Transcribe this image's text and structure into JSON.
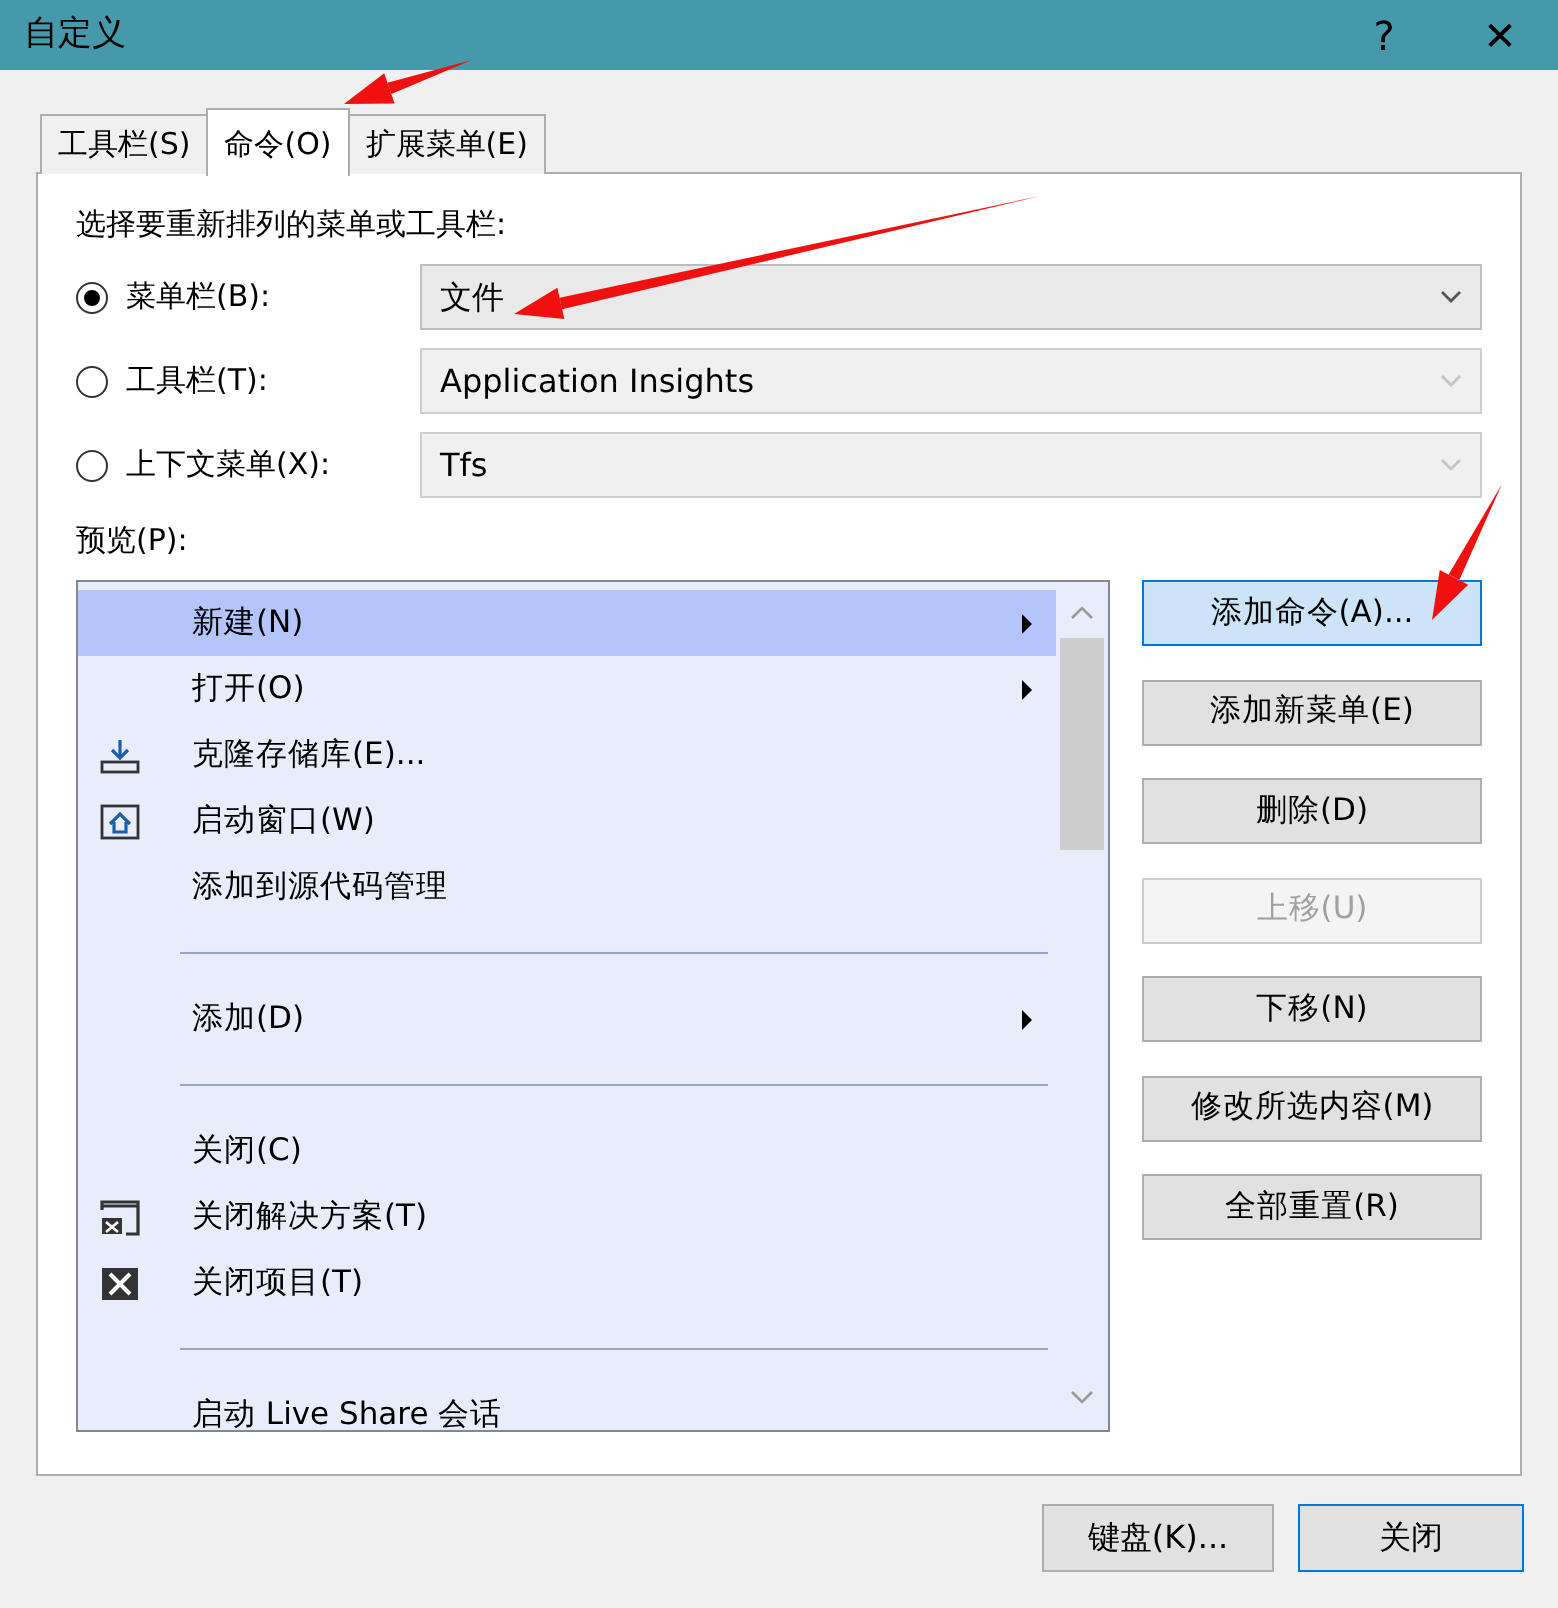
{
  "window": {
    "title": "自定义",
    "help": "?",
    "close": "✕"
  },
  "tabs": [
    {
      "label": "工具栏(S)",
      "selected": false
    },
    {
      "label": "命令(O)",
      "selected": true
    },
    {
      "label": "扩展菜单(E)",
      "selected": false
    }
  ],
  "prompt": "选择要重新排列的菜单或工具栏:",
  "targets": [
    {
      "label": "菜单栏(B):",
      "selected": true,
      "value": "文件",
      "disabled": false
    },
    {
      "label": "工具栏(T):",
      "selected": false,
      "value": "Application Insights",
      "disabled": true
    },
    {
      "label": "上下文菜单(X):",
      "selected": false,
      "value": "Tfs",
      "disabled": true
    }
  ],
  "preview_label": "预览(P):",
  "preview_items": [
    {
      "kind": "item",
      "label": "新建(N)",
      "submenu": true,
      "selected": true
    },
    {
      "kind": "item",
      "label": "打开(O)",
      "submenu": true,
      "selected": false
    },
    {
      "kind": "item",
      "label": "克隆存储库(E)...",
      "submenu": false,
      "selected": false
    },
    {
      "kind": "item",
      "label": "启动窗口(W)",
      "submenu": false,
      "selected": false
    },
    {
      "kind": "item",
      "label": "添加到源代码管理",
      "submenu": false,
      "selected": false
    },
    {
      "kind": "separator"
    },
    {
      "kind": "item",
      "label": "添加(D)",
      "submenu": true,
      "selected": false
    },
    {
      "kind": "separator"
    },
    {
      "kind": "item",
      "label": "关闭(C)",
      "submenu": false,
      "selected": false
    },
    {
      "kind": "item",
      "label": "关闭解决方案(T)",
      "submenu": false,
      "selected": false
    },
    {
      "kind": "item",
      "label": "关闭项目(T)",
      "submenu": false,
      "selected": false
    },
    {
      "kind": "separator"
    },
    {
      "kind": "item",
      "label": "启动 Live Share 会话",
      "submenu": false,
      "selected": false
    }
  ],
  "side_buttons": [
    {
      "label": "添加命令(A)...",
      "default": true,
      "disabled": false
    },
    {
      "label": "添加新菜单(E)",
      "default": false,
      "disabled": false
    },
    {
      "label": "删除(D)",
      "default": false,
      "disabled": false
    },
    {
      "label": "上移(U)",
      "default": false,
      "disabled": true
    },
    {
      "label": "下移(N)",
      "default": false,
      "disabled": false
    },
    {
      "label": "修改所选内容(M)",
      "default": false,
      "disabled": false
    },
    {
      "label": "全部重置(R)",
      "default": false,
      "disabled": false
    }
  ],
  "footer_buttons": [
    {
      "label": "键盘(K)...",
      "default": false
    },
    {
      "label": "关闭",
      "default": true
    }
  ]
}
